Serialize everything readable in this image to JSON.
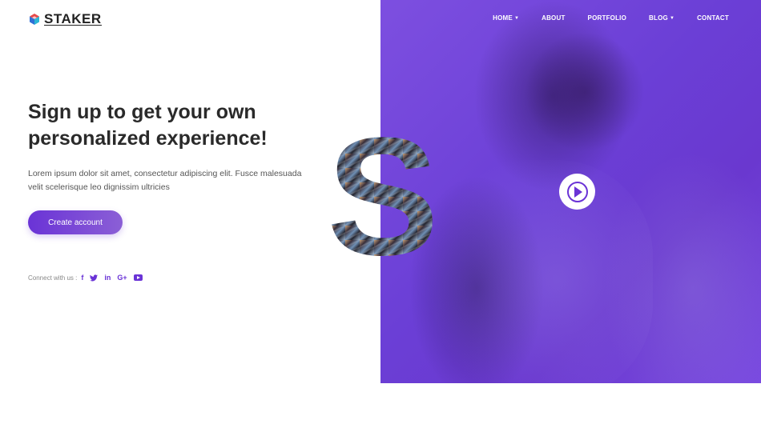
{
  "brand": {
    "name": "STAKER",
    "icon": "staker-logo-icon",
    "colors": {
      "red": "#e84a4a",
      "blue": "#2f6fd6",
      "cyan": "#2bb6d6"
    }
  },
  "nav": {
    "items": [
      {
        "label": "HOME",
        "dropdown": true
      },
      {
        "label": "ABOUT",
        "dropdown": false
      },
      {
        "label": "PORTFOLIO",
        "dropdown": false
      },
      {
        "label": "BLOG",
        "dropdown": true
      },
      {
        "label": "CONTACT",
        "dropdown": false
      }
    ]
  },
  "hero": {
    "headline_line1": "Sign up to get your own",
    "headline_line2": "personalized experience!",
    "lead": "Lorem ipsum dolor sit amet, consectetur adipiscing elit. Fusce malesuada velit scelerisque leo dignissim ultricies",
    "cta_label": "Create account",
    "big_letter": "S"
  },
  "social": {
    "label": "Connect with us :",
    "icons": [
      "facebook-icon",
      "twitter-icon",
      "linkedin-icon",
      "google-plus-icon",
      "youtube-icon"
    ],
    "glyphs": {
      "facebook": "f",
      "linkedin": "in",
      "google_plus": "G+"
    }
  },
  "colors": {
    "accent": "#6a33d6",
    "accent_light": "#8b5fd6",
    "panel": "#6b3fd6",
    "heading": "#2a2a2a",
    "body": "#555555"
  },
  "video": {
    "icon": "play-icon"
  }
}
